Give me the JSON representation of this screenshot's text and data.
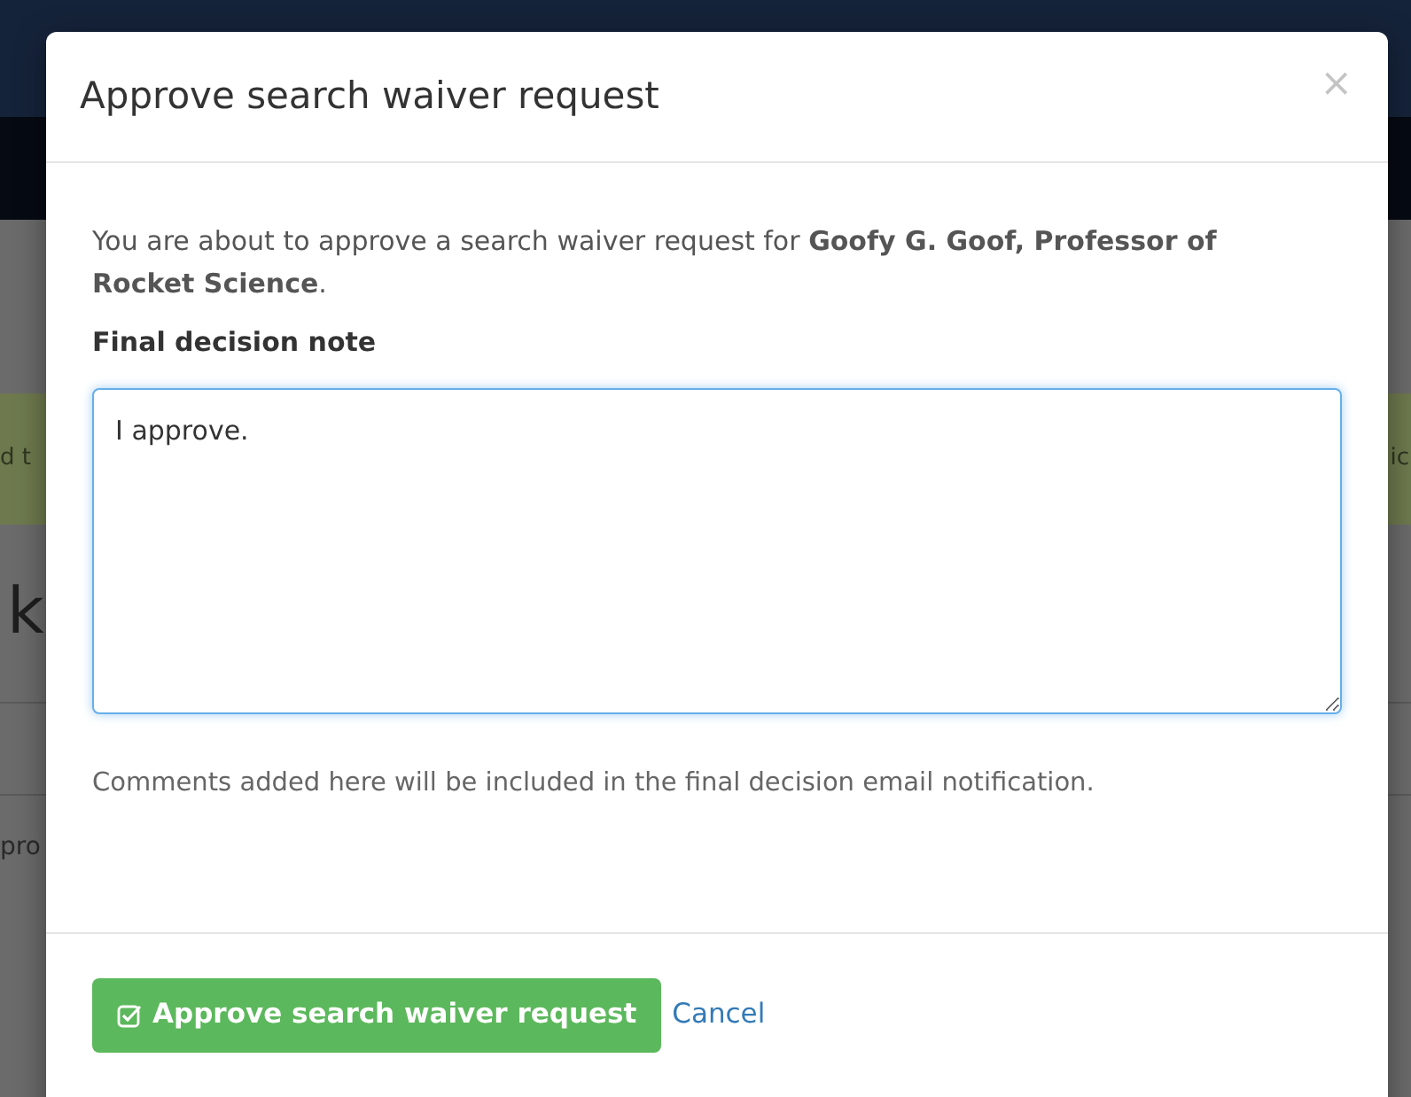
{
  "background": {
    "alert_left": "d t",
    "alert_right": "ic",
    "heading": "k",
    "row_text": "pro"
  },
  "modal": {
    "title": "Approve search waiver request",
    "close": "×",
    "message": "You are about to approve a search waiver request for **Goofy G. Goof, Professor of Rocket Science**.",
    "field": {
      "label": "Final decision note",
      "value": "I approve.",
      "focused": true
    },
    "help": "Comments added here will be included in the final decision email notification.",
    "buttons": [
      {
        "kind": "primary",
        "label": "Approve search waiver request"
      },
      {
        "kind": "link",
        "label": "Cancel"
      }
    ]
  }
}
